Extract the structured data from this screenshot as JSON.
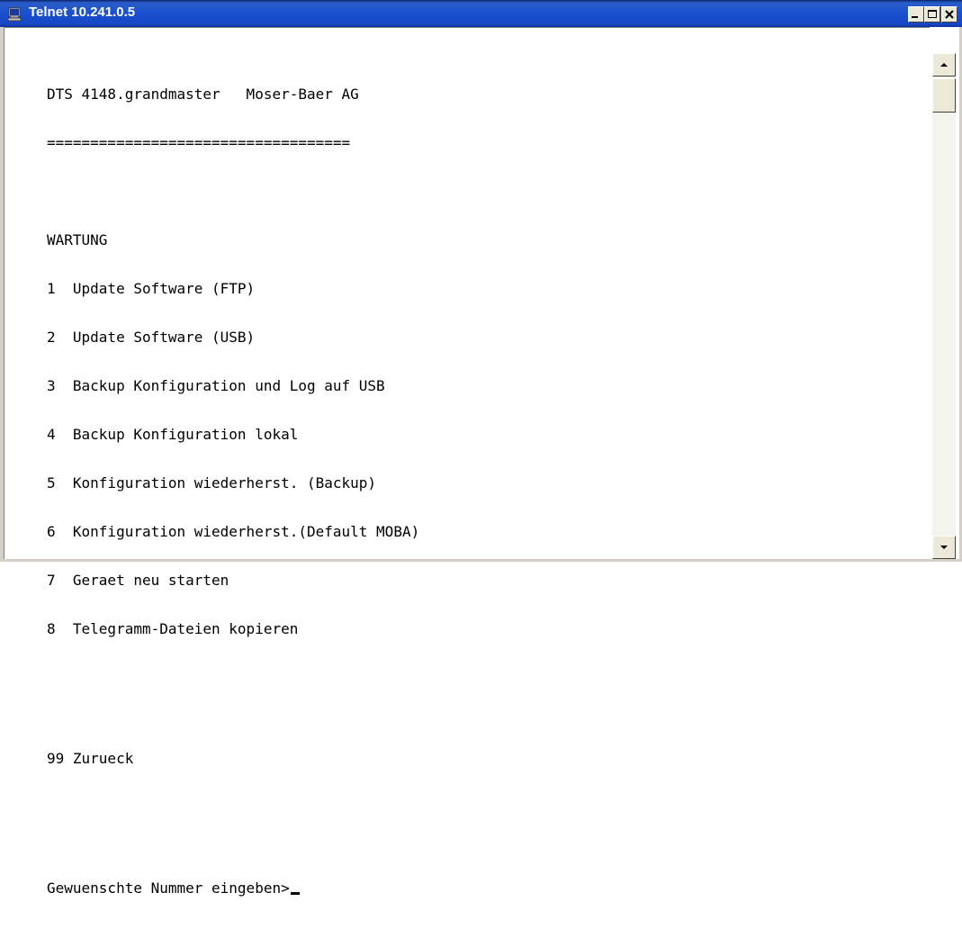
{
  "window": {
    "title": "Telnet 10.241.0.5",
    "icon": "telnet-terminal-icon",
    "buttons": {
      "minimize_icon": "minimize-icon",
      "maximize_icon": "maximize-icon",
      "close_icon": "close-icon"
    }
  },
  "terminal": {
    "header": "DTS 4148.grandmaster   Moser-Baer AG",
    "separator": "===================================",
    "menu_title": "WARTUNG",
    "menu_items": [
      "1  Update Software (FTP)",
      "2  Update Software (USB)",
      "3  Backup Konfiguration und Log auf USB",
      "4  Backup Konfiguration lokal",
      "5  Konfiguration wiederherst. (Backup)",
      "6  Konfiguration wiederherst.(Default MOBA)",
      "7  Geraet neu starten",
      "8  Telegramm-Dateien kopieren"
    ],
    "back_item": "99 Zurueck",
    "prompt": "Gewuenschte Nummer eingeben>"
  },
  "scrollbar": {
    "up_icon": "scroll-up-arrow-icon",
    "down_icon": "scroll-down-arrow-icon"
  }
}
